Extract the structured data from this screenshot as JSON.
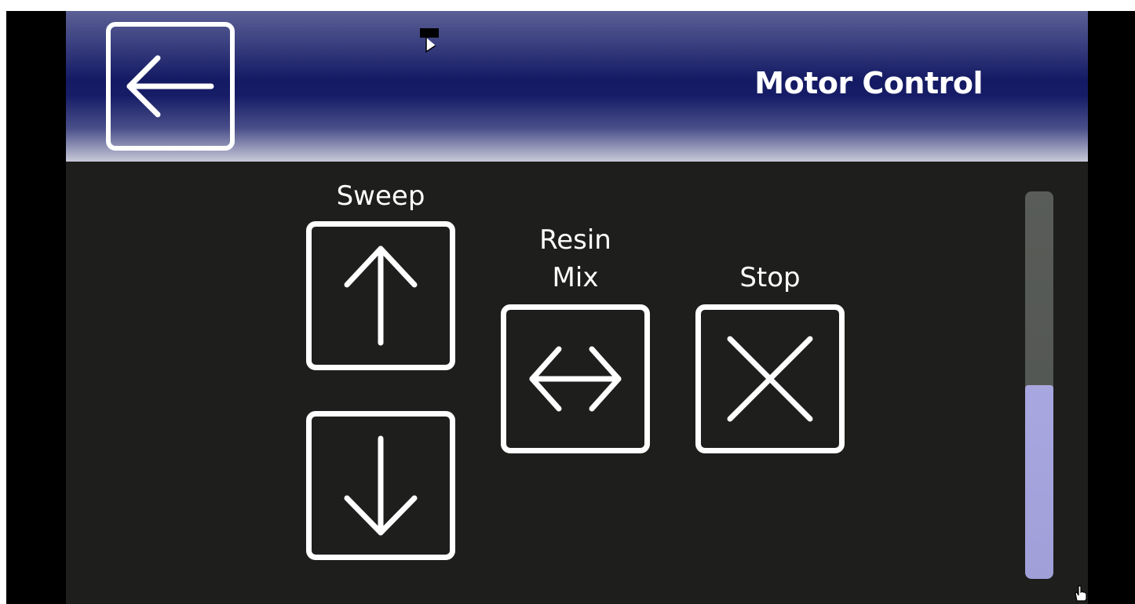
{
  "header": {
    "title": "Motor Control"
  },
  "controls": {
    "sweep": {
      "label": "Sweep"
    },
    "resin_mix": {
      "label_line1": "Resin",
      "label_line2": "Mix"
    },
    "stop": {
      "label": "Stop"
    }
  },
  "icons": {
    "back": "arrow-left-icon",
    "sweep_up": "arrow-up-icon",
    "sweep_down": "arrow-down-icon",
    "resin_mix": "arrow-left-right-icon",
    "stop": "x-icon"
  },
  "scrollbar": {
    "fill_fraction": 0.5
  },
  "colors": {
    "header_dark": "#141a63",
    "panel_bg": "#1e1e1c",
    "scroll_fill": "#a9a7e0",
    "scroll_track": "#595c58",
    "foreground": "#ffffff"
  }
}
